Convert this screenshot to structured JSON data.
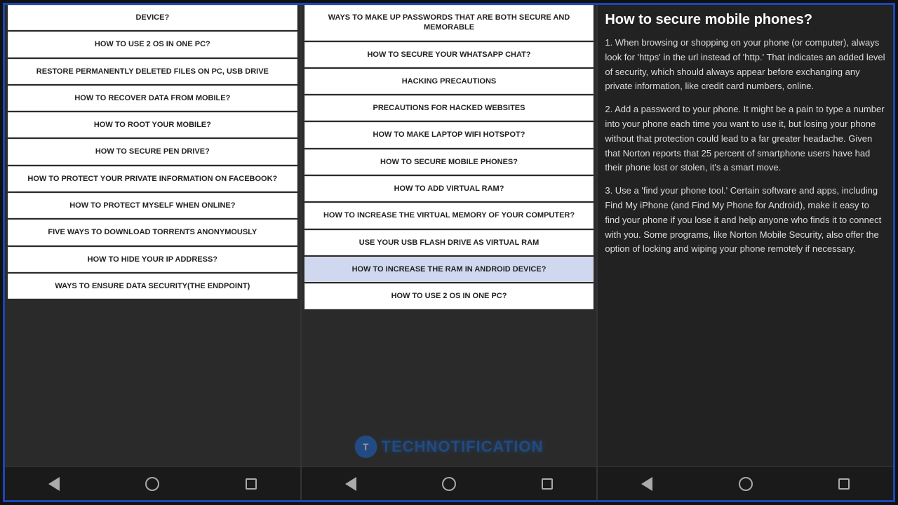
{
  "screens": [
    {
      "id": "screen1",
      "type": "menu",
      "top_item": "DEVICE?",
      "items": [
        "HOW TO USE 2 OS IN ONE PC?",
        "RESTORE PERMANENTLY DELETED FILES ON PC, USB DRIVE",
        "HOW TO RECOVER DATA FROM MOBILE?",
        "HOW TO ROOT YOUR MOBILE?",
        "HOW TO SECURE PEN DRIVE?",
        "HOW TO PROTECT YOUR PRIVATE INFORMATION ON FACEBOOK?",
        "HOW TO PROTECT MYSELF WHEN ONLINE?",
        "FIVE WAYS TO DOWNLOAD TORRENTS ANONYMOUSLY",
        "HOW TO HIDE YOUR IP ADDRESS?",
        "WAYS TO ENSURE DATA SECURITY(THE ENDPOINT)"
      ]
    },
    {
      "id": "screen2",
      "type": "menu",
      "top_item": "WAYS TO MAKE UP PASSWORDS THAT ARE BOTH SECURE AND MEMORABLE",
      "items": [
        "HOW TO SECURE YOUR WHATSAPP CHAT?",
        "HACKING PRECAUTIONS",
        "PRECAUTIONS FOR HACKED WEBSITES",
        "HOW TO MAKE LAPTOP WIFI HOTSPOT?",
        "HOW TO SECURE MOBILE PHONES?",
        "HOW TO ADD VIRTUAL RAM?",
        "HOW TO INCREASE THE VIRTUAL MEMORY OF YOUR COMPUTER?",
        "USE YOUR USB FLASH DRIVE AS VIRTUAL RAM",
        "HOW TO INCREASE THE RAM IN ANDROID DEVICE?",
        "HOW TO USE 2 OS IN ONE PC?"
      ],
      "watermark": {
        "logo": "T",
        "text": "TECHNOTIFICATION"
      }
    },
    {
      "id": "screen3",
      "type": "article",
      "title": "How to secure mobile phones?",
      "paragraphs": [
        "1. When browsing or shopping on your phone (or computer), always look for 'https' in the url instead of 'http.' That indicates an added level of security, which should always appear before exchanging any private information, like credit card numbers, online.",
        "2. Add a password to your phone. It might be a pain to type a number into your phone each time you want to use it, but losing your phone without that protection could lead to a far greater headache. Given that Norton reports that 25 percent of smartphone users have had their phone lost or stolen, it's a smart move.",
        "3. Use a 'find your phone tool.' Certain software and apps, including Find My iPhone (and Find My Phone for Android), make it easy to find your phone if you lose it and help anyone who finds it to connect with you. Some programs, like Norton Mobile Security, also offer the option of locking and wiping your phone remotely if necessary."
      ]
    }
  ],
  "nav": {
    "back_label": "back",
    "home_label": "home",
    "recents_label": "recents"
  }
}
